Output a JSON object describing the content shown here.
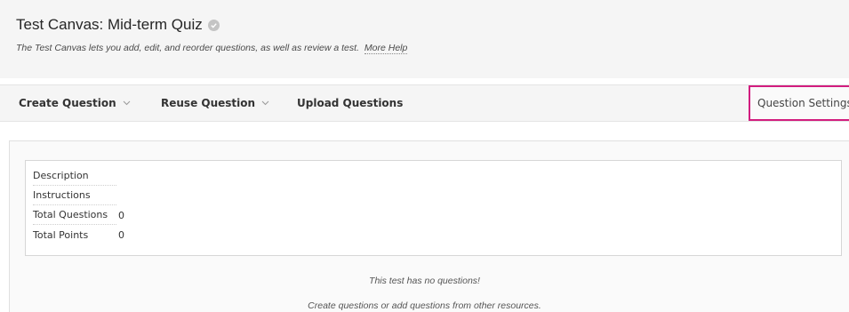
{
  "header": {
    "title": "Test Canvas: Mid-term Quiz",
    "status_icon": "checkmark-circle-icon",
    "description": "The Test Canvas lets you add, edit, and reorder questions, as well as review a test.",
    "help_link": "More Help"
  },
  "toolbar": {
    "create_question": "Create Question",
    "reuse_question": "Reuse Question",
    "upload_questions": "Upload Questions",
    "question_settings": "Question Settings",
    "highlight_color": "#d21d7f"
  },
  "test_info": {
    "rows": [
      {
        "label": "Description",
        "value": ""
      },
      {
        "label": "Instructions",
        "value": ""
      },
      {
        "label": "Total Questions",
        "value": "0"
      },
      {
        "label": "Total Points",
        "value": "0"
      }
    ]
  },
  "empty_state": {
    "message": "This test has no questions!",
    "hint": "Create questions or add questions from other resources."
  }
}
